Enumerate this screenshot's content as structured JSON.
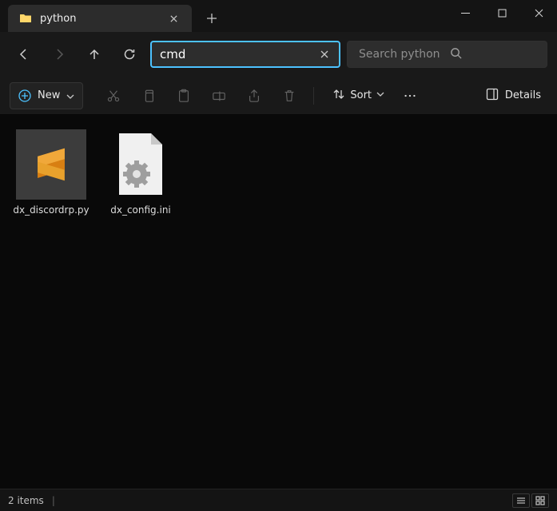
{
  "tab": {
    "title": "python"
  },
  "titlebar": {
    "close_tab_icon": "x-icon",
    "new_tab_icon": "plus-icon",
    "minimize_icon": "minimize-icon",
    "maximize_icon": "maximize-icon",
    "close_icon": "close-icon"
  },
  "nav": {
    "back_icon": "arrow-left-icon",
    "forward_icon": "arrow-right-icon",
    "up_icon": "arrow-up-icon",
    "refresh_icon": "refresh-icon"
  },
  "address": {
    "value": "cmd",
    "clear_icon": "x-icon"
  },
  "search": {
    "placeholder": "Search python",
    "icon": "search-icon"
  },
  "commands": {
    "new_label": "New",
    "new_icon": "plus-circle-icon",
    "chevron_icon": "chevron-down-icon",
    "cut_icon": "cut-icon",
    "copy_icon": "copy-icon",
    "paste_icon": "paste-icon",
    "rename_icon": "rename-icon",
    "share_icon": "share-icon",
    "delete_icon": "delete-icon",
    "sort_icon": "sort-icon",
    "sort_label": "Sort",
    "more_icon": "more-icon",
    "details_icon": "details-icon",
    "details_label": "Details"
  },
  "files": [
    {
      "name": "dx_discordrp.py",
      "kind": "sublime"
    },
    {
      "name": "dx_config.ini",
      "kind": "ini"
    }
  ],
  "status": {
    "count_label": "2 items",
    "list_view_icon": "list-view-icon",
    "grid_view_icon": "grid-view-icon"
  },
  "colors": {
    "accent": "#4cc2ff",
    "sublime_orange": "#e89c1e"
  }
}
